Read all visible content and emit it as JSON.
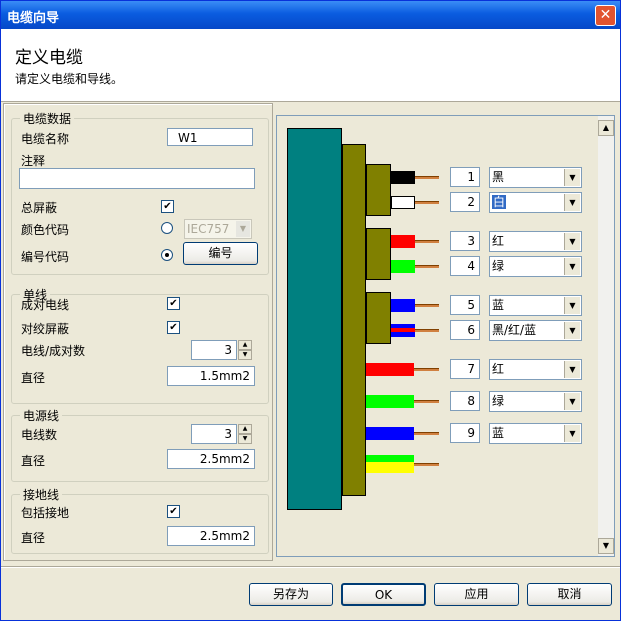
{
  "window": {
    "title": "电缆向导",
    "close_glyph": "✕"
  },
  "header": {
    "title": "定义电缆",
    "subtitle": "请定义电缆和导线。"
  },
  "cable_data": {
    "legend": "电缆数据",
    "name_label": "电缆名称",
    "name_value": "W1",
    "comment_label": "注释",
    "comment_value": "",
    "overall_shield_label": "总屏蔽",
    "overall_shield_checked": true,
    "color_code_label": "颜色代码",
    "color_code_value": "IEC757",
    "number_code_label": "编号代码",
    "number_button": "编号",
    "color_code_selected": false,
    "number_code_selected": true
  },
  "single_wire": {
    "legend": "单线",
    "paired_label": "成对电线",
    "paired_checked": true,
    "twisted_shield_label": "对绞屏蔽",
    "twisted_shield_checked": true,
    "count_label": "电线/成对数",
    "count_value": "3",
    "diameter_label": "直径",
    "diameter_value": "1.5mm2"
  },
  "power_wire": {
    "legend": "电源线",
    "count_label": "电线数",
    "count_value": "3",
    "diameter_label": "直径",
    "diameter_value": "2.5mm2"
  },
  "ground_wire": {
    "legend": "接地线",
    "include_label": "包括接地",
    "include_checked": true,
    "diameter_label": "直径",
    "diameter_value": "2.5mm2"
  },
  "wires": [
    {
      "num": "1",
      "color": "黑",
      "fill": "#000000"
    },
    {
      "num": "2",
      "color": "白",
      "fill": "#ffffff",
      "selected": true
    },
    {
      "num": "3",
      "color": "红",
      "fill": "#ff0000"
    },
    {
      "num": "4",
      "color": "绿",
      "fill": "#00ff00"
    },
    {
      "num": "5",
      "color": "蓝",
      "fill": "#0000ff"
    },
    {
      "num": "6",
      "color": "黑/红/蓝",
      "fill": "multi"
    },
    {
      "num": "7",
      "color": "红",
      "fill": "#ff0000"
    },
    {
      "num": "8",
      "color": "绿",
      "fill": "#00ff00"
    },
    {
      "num": "9",
      "color": "蓝",
      "fill": "#0000ff"
    }
  ],
  "ground_stripe": {
    "colors": [
      "#00ff00",
      "#ffff00"
    ]
  },
  "colors": {
    "cable_body": "#008080",
    "jacket": "#808000",
    "copper": "#d08040",
    "title_bar": "#0a5ce0"
  },
  "buttons": {
    "save_as": "另存为",
    "ok": "OK",
    "apply": "应用",
    "cancel": "取消"
  }
}
